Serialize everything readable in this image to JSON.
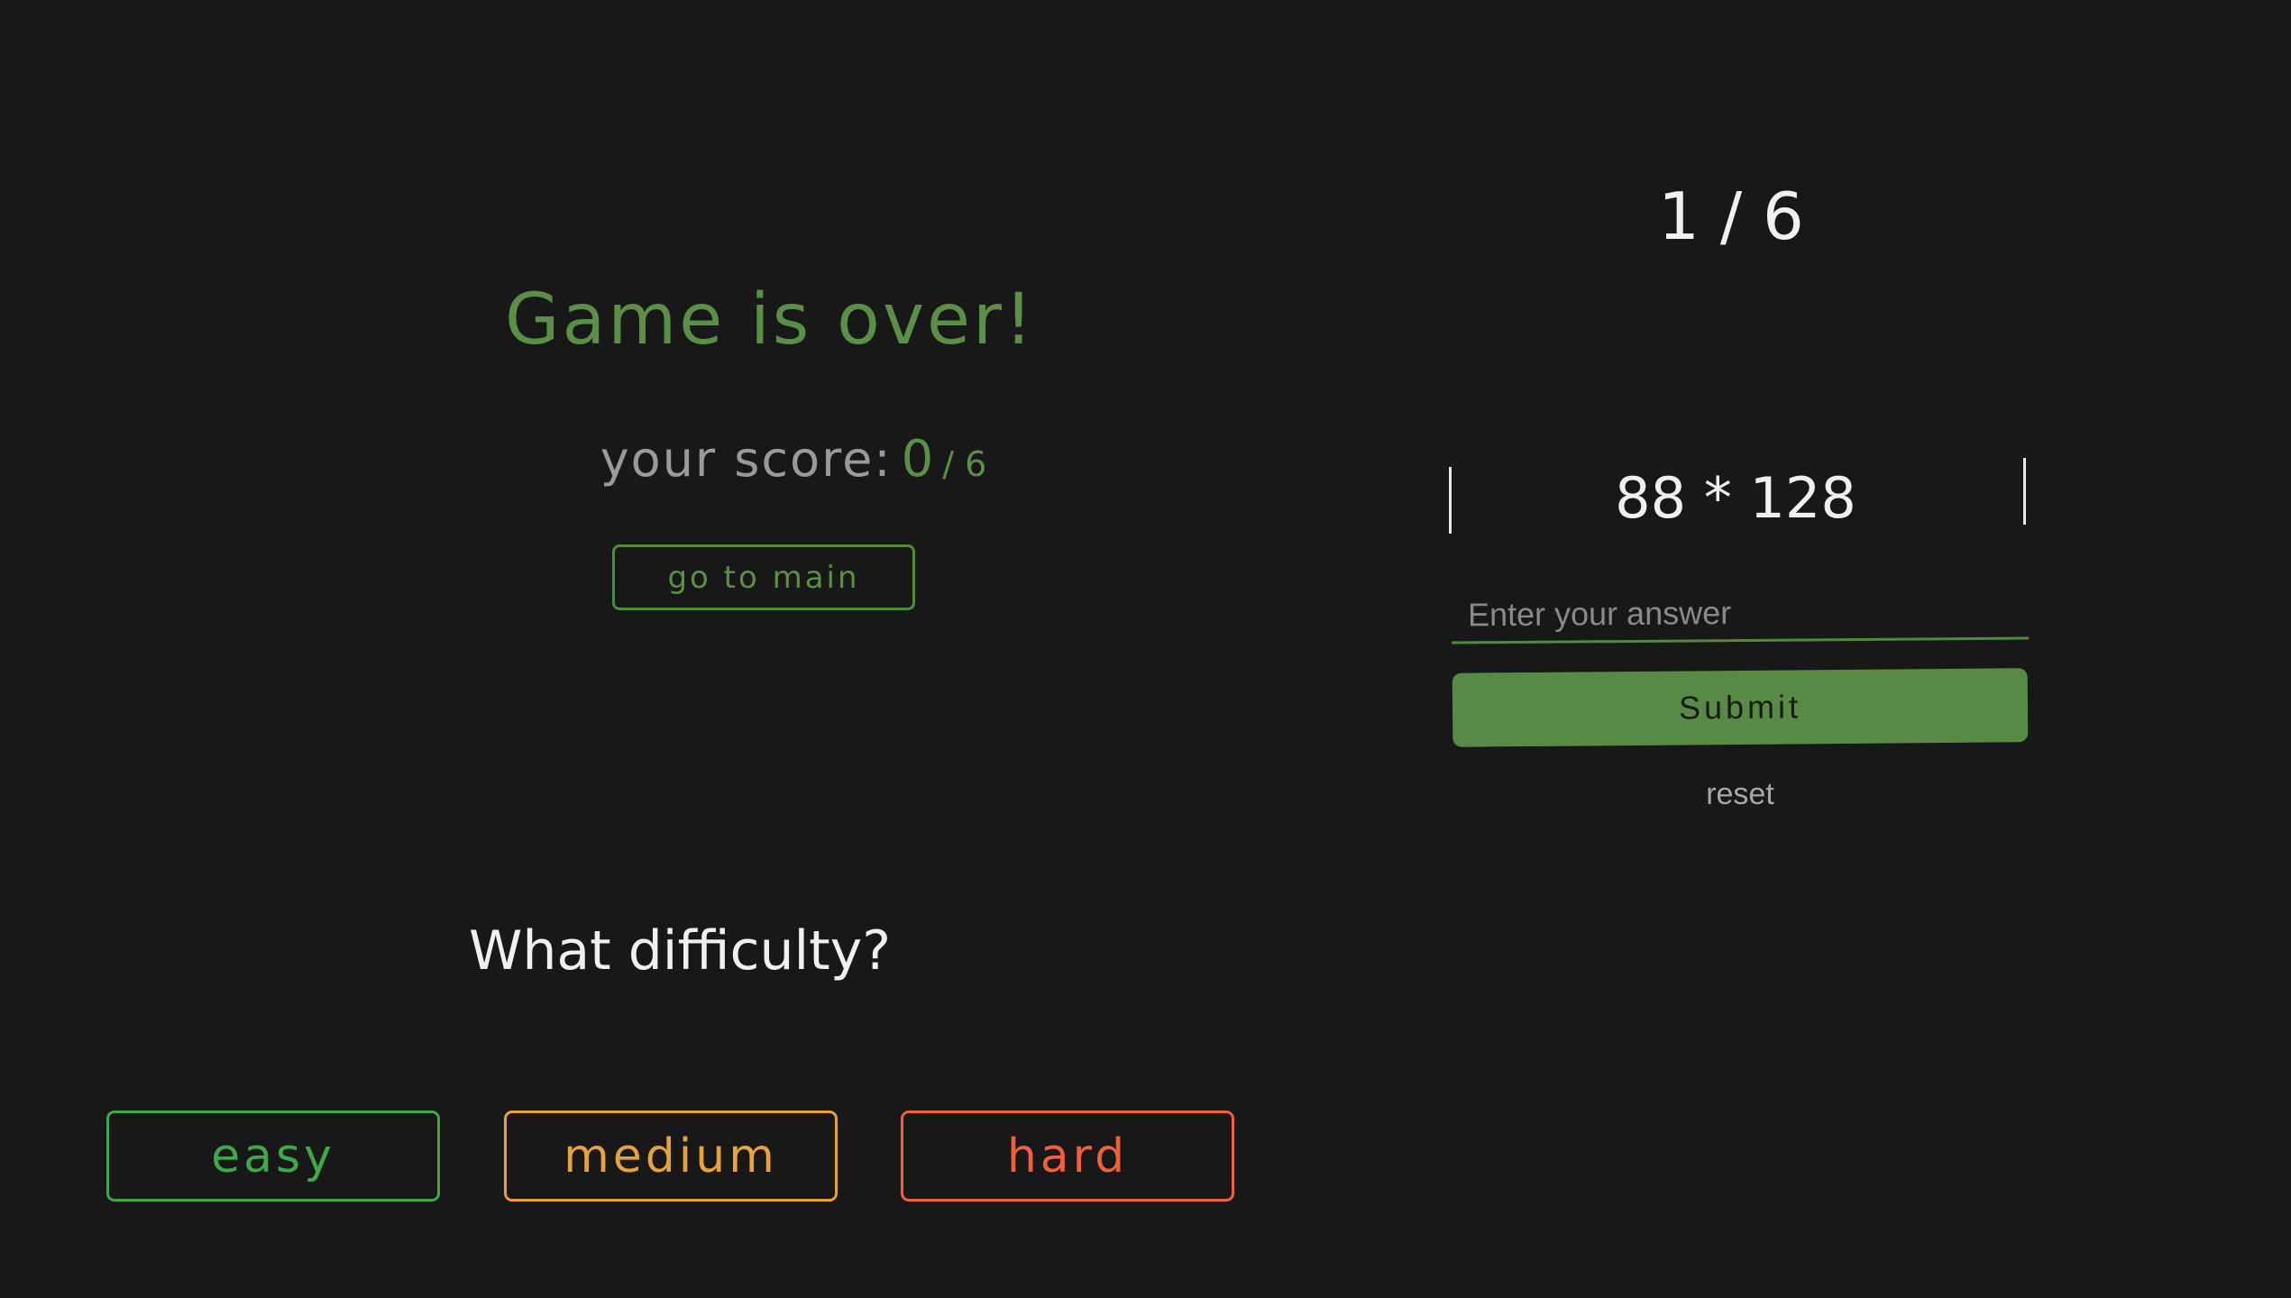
{
  "game_over": {
    "title": "Game is over!",
    "score_label": "your score:",
    "score_value": "0",
    "score_total": "/ 6",
    "go_main_label": "go to main"
  },
  "difficulty": {
    "title": "What difficulty?",
    "options": [
      {
        "label": "easy",
        "color": "#3fa84a"
      },
      {
        "label": "medium",
        "color": "#e6a23c"
      },
      {
        "label": "hard",
        "color": "#f0603c"
      }
    ]
  },
  "quiz": {
    "progress": "1 / 6",
    "question": "88 * 128",
    "answer_value": "",
    "answer_placeholder": "Enter your answer",
    "submit_label": "Submit",
    "reset_label": "reset"
  },
  "colors": {
    "background": "#181818",
    "accent": "#568a45"
  }
}
